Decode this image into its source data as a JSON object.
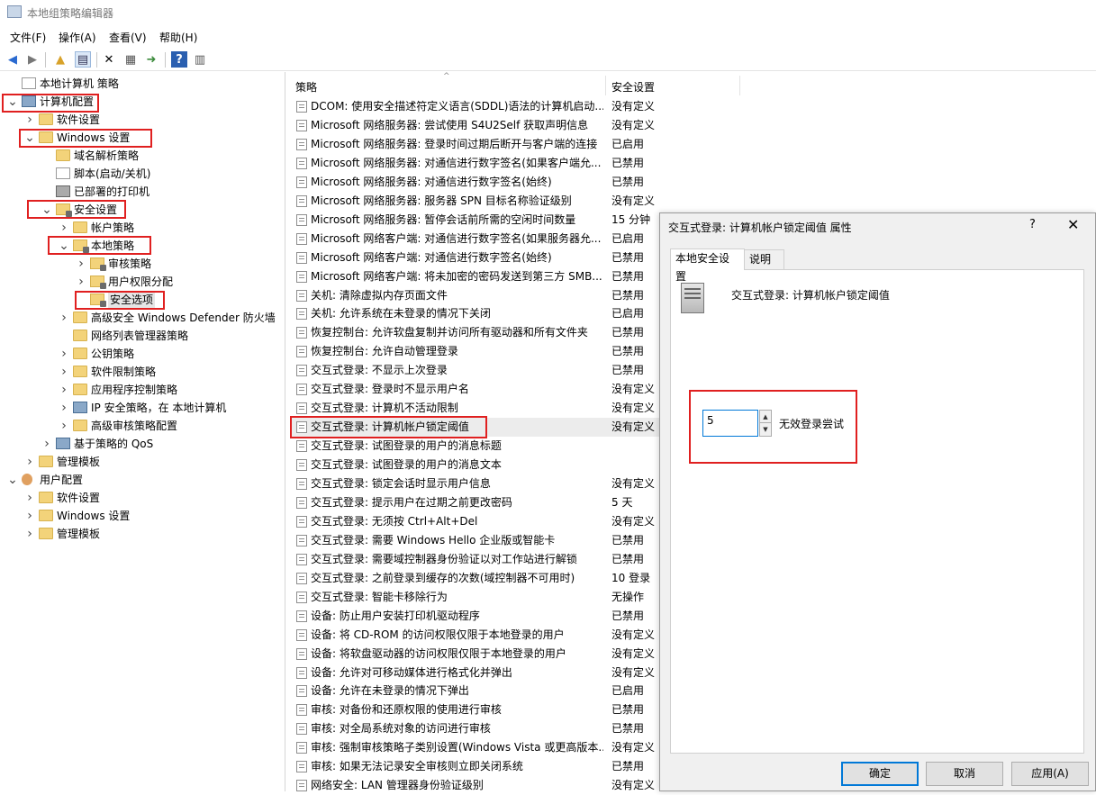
{
  "window": {
    "title": "本地组策略编辑器"
  },
  "menu": [
    "文件(F)",
    "操作(A)",
    "查看(V)",
    "帮助(H)"
  ],
  "toolbar": {
    "icons": [
      "back-arrow-icon",
      "forward-arrow-icon",
      "up-folder-icon",
      "show-hide-tree-icon",
      "delete-icon",
      "properties-icon",
      "export-icon",
      "help-icon",
      "view-icon"
    ]
  },
  "tree": [
    {
      "label": "本地计算机 策略",
      "level": 0,
      "icon": "doc",
      "toggle": ""
    },
    {
      "label": "计算机配置",
      "level": 0,
      "icon": "comp",
      "toggle": "v",
      "boxed": true
    },
    {
      "label": "软件设置",
      "level": 1,
      "icon": "folder",
      "toggle": ">"
    },
    {
      "label": "Windows 设置",
      "level": 1,
      "icon": "folder",
      "toggle": "v",
      "boxed": true
    },
    {
      "label": "域名解析策略",
      "level": 2,
      "icon": "folder",
      "toggle": ""
    },
    {
      "label": "脚本(启动/关机)",
      "level": 2,
      "icon": "doc",
      "toggle": ""
    },
    {
      "label": "已部署的打印机",
      "level": 2,
      "icon": "printer",
      "toggle": ""
    },
    {
      "label": "安全设置",
      "level": 2,
      "icon": "lockfolder",
      "toggle": "v",
      "boxed": true
    },
    {
      "label": "帐户策略",
      "level": 3,
      "icon": "folder",
      "toggle": ">"
    },
    {
      "label": "本地策略",
      "level": 3,
      "icon": "lockfolder",
      "toggle": "v",
      "boxed": true
    },
    {
      "label": "审核策略",
      "level": 4,
      "icon": "lockfolder",
      "toggle": ">"
    },
    {
      "label": "用户权限分配",
      "level": 4,
      "icon": "lockfolder",
      "toggle": ">"
    },
    {
      "label": "安全选项",
      "level": 4,
      "icon": "lockfolder",
      "toggle": "",
      "boxed": true,
      "selected": true
    },
    {
      "label": "高级安全 Windows Defender 防火墙",
      "level": 3,
      "icon": "folder",
      "toggle": ">"
    },
    {
      "label": "网络列表管理器策略",
      "level": 3,
      "icon": "folder",
      "toggle": ""
    },
    {
      "label": "公钥策略",
      "level": 3,
      "icon": "folder",
      "toggle": ">"
    },
    {
      "label": "软件限制策略",
      "level": 3,
      "icon": "folder",
      "toggle": ">"
    },
    {
      "label": "应用程序控制策略",
      "level": 3,
      "icon": "folder",
      "toggle": ">"
    },
    {
      "label": "IP 安全策略，在 本地计算机",
      "level": 3,
      "icon": "comp",
      "toggle": ">"
    },
    {
      "label": "高级审核策略配置",
      "level": 3,
      "icon": "folder",
      "toggle": ">"
    },
    {
      "label": "基于策略的 QoS",
      "level": 2,
      "icon": "comp",
      "toggle": ">"
    },
    {
      "label": "管理模板",
      "level": 1,
      "icon": "folder",
      "toggle": ">"
    },
    {
      "label": "用户配置",
      "level": 0,
      "icon": "user",
      "toggle": "v"
    },
    {
      "label": "软件设置",
      "level": 1,
      "icon": "folder",
      "toggle": ">"
    },
    {
      "label": "Windows 设置",
      "level": 1,
      "icon": "folder",
      "toggle": ">"
    },
    {
      "label": "管理模板",
      "level": 1,
      "icon": "folder",
      "toggle": ">"
    }
  ],
  "list": {
    "col_policy": "策略",
    "col_setting": "安全设置",
    "rows": [
      {
        "name": "DCOM: 使用安全描述符定义语言(SDDL)语法的计算机启动...",
        "setting": "没有定义"
      },
      {
        "name": "Microsoft 网络服务器: 尝试使用 S4U2Self 获取声明信息",
        "setting": "没有定义"
      },
      {
        "name": "Microsoft 网络服务器: 登录时间过期后断开与客户端的连接",
        "setting": "已启用"
      },
      {
        "name": "Microsoft 网络服务器: 对通信进行数字签名(如果客户端允...",
        "setting": "已禁用"
      },
      {
        "name": "Microsoft 网络服务器: 对通信进行数字签名(始终)",
        "setting": "已禁用"
      },
      {
        "name": "Microsoft 网络服务器: 服务器 SPN 目标名称验证级别",
        "setting": "没有定义"
      },
      {
        "name": "Microsoft 网络服务器: 暂停会话前所需的空闲时间数量",
        "setting": "15 分钟"
      },
      {
        "name": "Microsoft 网络客户端: 对通信进行数字签名(如果服务器允...",
        "setting": "已启用"
      },
      {
        "name": "Microsoft 网络客户端: 对通信进行数字签名(始终)",
        "setting": "已禁用"
      },
      {
        "name": "Microsoft 网络客户端: 将未加密的密码发送到第三方 SMB...",
        "setting": "已禁用"
      },
      {
        "name": "关机: 清除虚拟内存页面文件",
        "setting": "已禁用"
      },
      {
        "name": "关机: 允许系统在未登录的情况下关闭",
        "setting": "已启用"
      },
      {
        "name": "恢复控制台: 允许软盘复制并访问所有驱动器和所有文件夹",
        "setting": "已禁用"
      },
      {
        "name": "恢复控制台: 允许自动管理登录",
        "setting": "已禁用"
      },
      {
        "name": "交互式登录: 不显示上次登录",
        "setting": "已禁用"
      },
      {
        "name": "交互式登录: 登录时不显示用户名",
        "setting": "没有定义"
      },
      {
        "name": "交互式登录: 计算机不活动限制",
        "setting": "没有定义"
      },
      {
        "name": "交互式登录: 计算机帐户锁定阈值",
        "setting": "没有定义",
        "selected": true
      },
      {
        "name": "交互式登录: 试图登录的用户的消息标题",
        "setting": ""
      },
      {
        "name": "交互式登录: 试图登录的用户的消息文本",
        "setting": ""
      },
      {
        "name": "交互式登录: 锁定会话时显示用户信息",
        "setting": "没有定义"
      },
      {
        "name": "交互式登录: 提示用户在过期之前更改密码",
        "setting": "5 天"
      },
      {
        "name": "交互式登录: 无须按 Ctrl+Alt+Del",
        "setting": "没有定义"
      },
      {
        "name": "交互式登录: 需要 Windows Hello 企业版或智能卡",
        "setting": "已禁用"
      },
      {
        "name": "交互式登录: 需要域控制器身份验证以对工作站进行解锁",
        "setting": "已禁用"
      },
      {
        "name": "交互式登录: 之前登录到缓存的次数(域控制器不可用时)",
        "setting": "10 登录"
      },
      {
        "name": "交互式登录: 智能卡移除行为",
        "setting": "无操作"
      },
      {
        "name": "设备: 防止用户安装打印机驱动程序",
        "setting": "已禁用"
      },
      {
        "name": "设备: 将 CD-ROM 的访问权限仅限于本地登录的用户",
        "setting": "没有定义"
      },
      {
        "name": "设备: 将软盘驱动器的访问权限仅限于本地登录的用户",
        "setting": "没有定义"
      },
      {
        "name": "设备: 允许对可移动媒体进行格式化并弹出",
        "setting": "没有定义"
      },
      {
        "name": "设备: 允许在未登录的情况下弹出",
        "setting": "已启用"
      },
      {
        "name": "审核: 对备份和还原权限的使用进行审核",
        "setting": "已禁用"
      },
      {
        "name": "审核: 对全局系统对象的访问进行审核",
        "setting": "已禁用"
      },
      {
        "name": "审核: 强制审核策略子类别设置(Windows Vista 或更高版本...",
        "setting": "没有定义"
      },
      {
        "name": "审核: 如果无法记录安全审核则立即关闭系统",
        "setting": "已禁用"
      },
      {
        "name": "网络安全: LAN 管理器身份验证级别",
        "setting": "没有定义"
      }
    ]
  },
  "dialog": {
    "title": "交互式登录: 计算机帐户锁定阈值 属性",
    "help": "?",
    "close": "✕",
    "tabs": [
      "本地安全设置",
      "说明"
    ],
    "policy_name": "交互式登录: 计算机帐户锁定阈值",
    "value": "5",
    "value_label": "无效登录尝试",
    "ok": "确定",
    "cancel": "取消",
    "apply": "应用(A)"
  }
}
